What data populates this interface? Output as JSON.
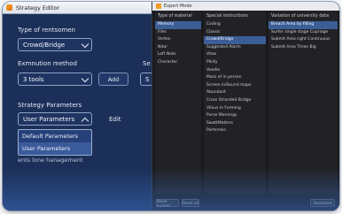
{
  "editor": {
    "title": "Strategy Editor",
    "type_label": "Type of rentsomen",
    "type_value": "Crowd/Bridge",
    "method_label": "Exmnution method",
    "method_value": "3 tools",
    "add_label": "Add",
    "se_label": "Se",
    "s_value": "S",
    "params_label": "Strategy Parameters",
    "params_value": "User Parameters",
    "edit_label": "Edit",
    "dropdown_options": [
      "Default Parameters",
      "User Parameters"
    ],
    "dropdown_selected": "User Parameters",
    "trailing_text": "ents lone hanagement"
  },
  "expert": {
    "title": "Expert Mode",
    "col1_header": "Type of material",
    "col1_items": [
      "Memory",
      "Files",
      "Vertex",
      "Nitor",
      "Loft Note",
      "Character"
    ],
    "col1_selected": 0,
    "col2_header": "Special instructions",
    "col2_items": [
      "Coding",
      "Classic",
      "Crowd/Bridge",
      "Suggested Alarm",
      "Vitas",
      "Plinty",
      "Voodie",
      "Mass of in person",
      "Screen in/Sound maps",
      "Abundant",
      "Cross Stranded Bridge",
      "Vilous in Forming",
      "Purse Mornings",
      "SwattMatters",
      "Porterrain"
    ],
    "col2_selected": 2,
    "col3_header": "Variation of university data",
    "col3_items": [
      "Breach Area by filling",
      "Surfer single stage Cupriage",
      "Submit Area right Continuous",
      "Submit Area Three Big"
    ],
    "col3_selected": 0,
    "footer_btn1": "Reset current",
    "footer_btn2": "Reset all",
    "footer_btn3": "Download"
  }
}
